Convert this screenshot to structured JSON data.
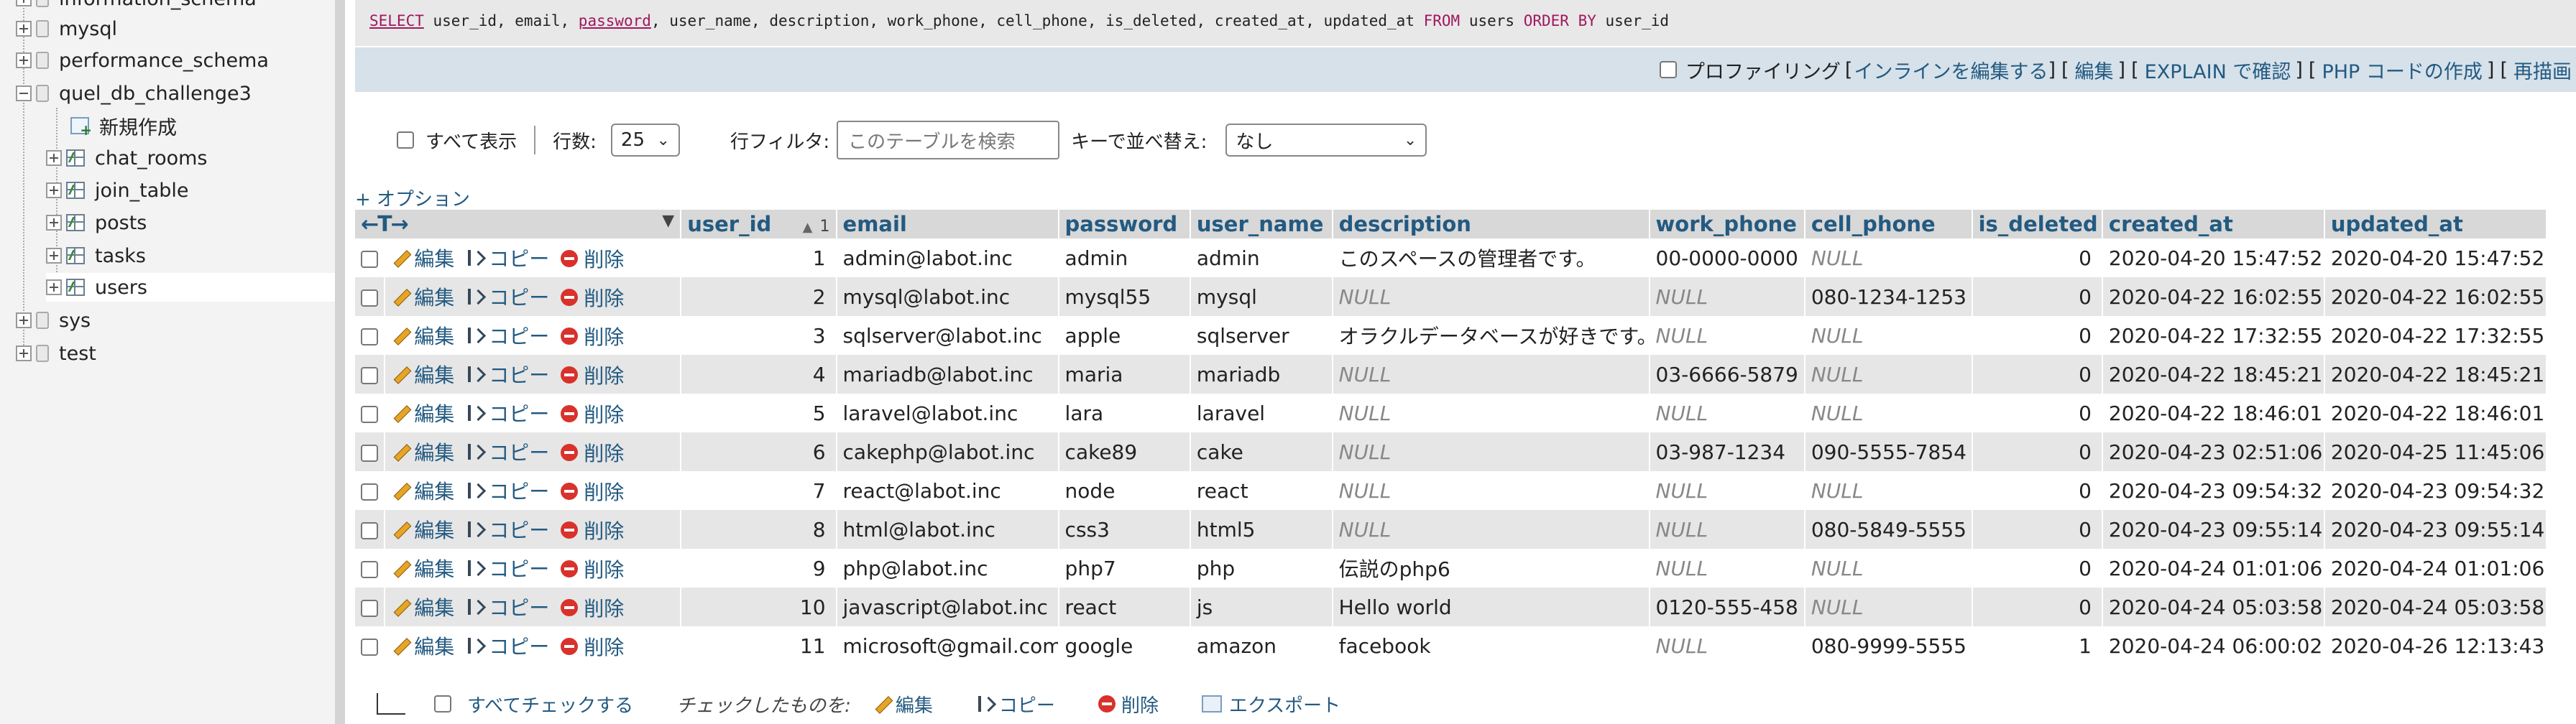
{
  "sidebar": {
    "items": [
      {
        "label": "information_schema",
        "type": "db"
      },
      {
        "label": "mysql",
        "type": "db"
      },
      {
        "label": "performance_schema",
        "type": "db"
      },
      {
        "label": "quel_db_challenge3",
        "type": "db"
      },
      {
        "label": "新規作成",
        "type": "new"
      },
      {
        "label": "chat_rooms",
        "type": "table"
      },
      {
        "label": "join_table",
        "type": "table"
      },
      {
        "label": "posts",
        "type": "table"
      },
      {
        "label": "tasks",
        "type": "table"
      },
      {
        "label": "users",
        "type": "table"
      },
      {
        "label": "sys",
        "type": "db"
      },
      {
        "label": "test",
        "type": "db"
      }
    ]
  },
  "sql": {
    "select_kw": "SELECT",
    "cols1": " user_id, email, ",
    "password_kw": "password",
    "cols2": ", user_name, description, work_phone, cell_phone, is_deleted, created_at, updated_at ",
    "from_kw": "FROM",
    "table": " users ",
    "order_kw": "ORDER BY",
    "order_col": " user_id"
  },
  "options_bar": {
    "profiling": "プロファイリング",
    "inline_edit": "インラインを編集する",
    "edit": "編集",
    "explain": "EXPLAIN で確認",
    "php_code": "PHP コードの作成",
    "refresh": "再描画"
  },
  "controls": {
    "show_all": "すべて表示",
    "rows_label": "行数:",
    "rows_value": "25",
    "filter_label": "行フィルタ:",
    "filter_placeholder": "このテーブルを検索",
    "sort_label": "キーで並べ替え:",
    "sort_value": "なし"
  },
  "plus_options": "+ オプション",
  "actions": {
    "edit": "編集",
    "copy": "コピー",
    "delete": "削除"
  },
  "columns": [
    "user_id",
    "email",
    "password",
    "user_name",
    "description",
    "work_phone",
    "cell_phone",
    "is_deleted",
    "created_at",
    "updated_at"
  ],
  "sort_indicator": "1",
  "rows": [
    {
      "user_id": "1",
      "email": "admin@labot.inc",
      "password": "admin",
      "user_name": "admin",
      "description": "このスペースの管理者です。",
      "work_phone": "00-0000-0000",
      "cell_phone": "NULL",
      "is_deleted": "0",
      "created_at": "2020-04-20 15:47:52",
      "updated_at": "2020-04-20 15:47:52"
    },
    {
      "user_id": "2",
      "email": "mysql@labot.inc",
      "password": "mysql55",
      "user_name": "mysql",
      "description": "NULL",
      "work_phone": "NULL",
      "cell_phone": "080-1234-1253",
      "is_deleted": "0",
      "created_at": "2020-04-22 16:02:55",
      "updated_at": "2020-04-22 16:02:55"
    },
    {
      "user_id": "3",
      "email": "sqlserver@labot.inc",
      "password": "apple",
      "user_name": "sqlserver",
      "description": "オラクルデータベースが好きです。",
      "work_phone": "NULL",
      "cell_phone": "NULL",
      "is_deleted": "0",
      "created_at": "2020-04-22 17:32:55",
      "updated_at": "2020-04-22 17:32:55"
    },
    {
      "user_id": "4",
      "email": "mariadb@labot.inc",
      "password": "maria",
      "user_name": "mariadb",
      "description": "NULL",
      "work_phone": "03-6666-5879",
      "cell_phone": "NULL",
      "is_deleted": "0",
      "created_at": "2020-04-22 18:45:21",
      "updated_at": "2020-04-22 18:45:21"
    },
    {
      "user_id": "5",
      "email": "laravel@labot.inc",
      "password": "lara",
      "user_name": "laravel",
      "description": "NULL",
      "work_phone": "NULL",
      "cell_phone": "NULL",
      "is_deleted": "0",
      "created_at": "2020-04-22 18:46:01",
      "updated_at": "2020-04-22 18:46:01"
    },
    {
      "user_id": "6",
      "email": "cakephp@labot.inc",
      "password": "cake89",
      "user_name": "cake",
      "description": "NULL",
      "work_phone": "03-987-1234",
      "cell_phone": "090-5555-7854",
      "is_deleted": "0",
      "created_at": "2020-04-23 02:51:06",
      "updated_at": "2020-04-25 11:45:06"
    },
    {
      "user_id": "7",
      "email": "react@labot.inc",
      "password": "node",
      "user_name": "react",
      "description": "NULL",
      "work_phone": "NULL",
      "cell_phone": "NULL",
      "is_deleted": "0",
      "created_at": "2020-04-23 09:54:32",
      "updated_at": "2020-04-23 09:54:32"
    },
    {
      "user_id": "8",
      "email": "html@labot.inc",
      "password": "css3",
      "user_name": "html5",
      "description": "NULL",
      "work_phone": "NULL",
      "cell_phone": "080-5849-5555",
      "is_deleted": "0",
      "created_at": "2020-04-23 09:55:14",
      "updated_at": "2020-04-23 09:55:14"
    },
    {
      "user_id": "9",
      "email": "php@labot.inc",
      "password": "php7",
      "user_name": "php",
      "description": "伝説のphp6",
      "work_phone": "NULL",
      "cell_phone": "NULL",
      "is_deleted": "0",
      "created_at": "2020-04-24 01:01:06",
      "updated_at": "2020-04-24 01:01:06"
    },
    {
      "user_id": "10",
      "email": "javascript@labot.inc",
      "password": "react",
      "user_name": "js",
      "description": "Hello world",
      "work_phone": "0120-555-458",
      "cell_phone": "NULL",
      "is_deleted": "0",
      "created_at": "2020-04-24 05:03:58",
      "updated_at": "2020-04-24 05:03:58"
    },
    {
      "user_id": "11",
      "email": "microsoft@gmail.com",
      "password": "google",
      "user_name": "amazon",
      "description": "facebook",
      "work_phone": "NULL",
      "cell_phone": "080-9999-5555",
      "is_deleted": "1",
      "created_at": "2020-04-24 06:00:02",
      "updated_at": "2020-04-26 12:13:43"
    }
  ],
  "footer": {
    "check_all": "すべてチェックする",
    "checked_label": "チェックしたものを:",
    "edit": "編集",
    "copy": "コピー",
    "delete": "削除",
    "export": "エクスポート"
  }
}
